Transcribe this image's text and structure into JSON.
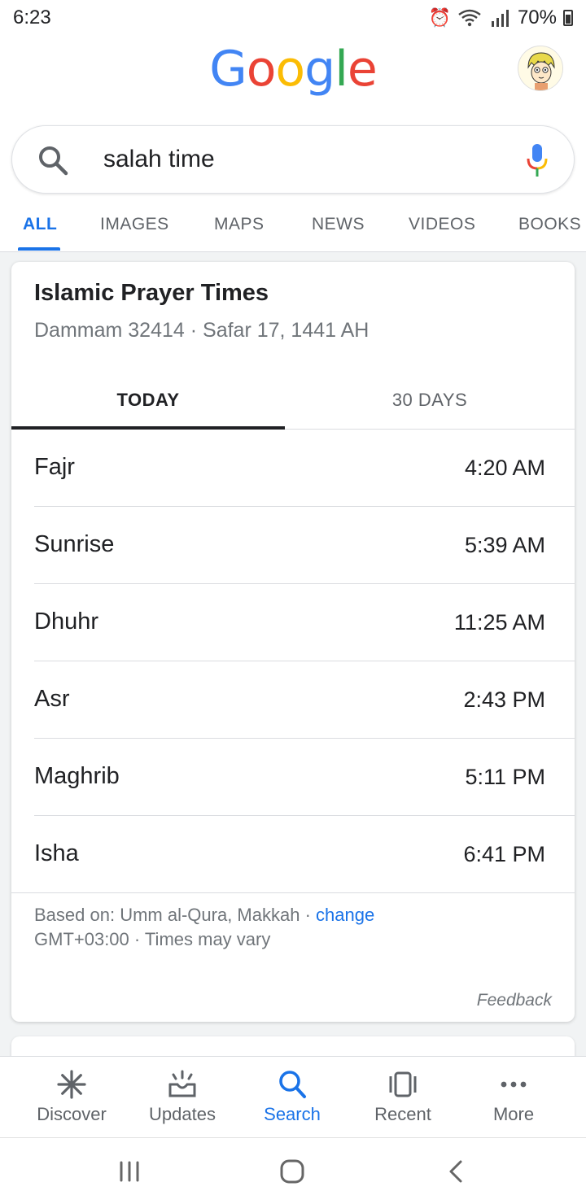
{
  "status_bar": {
    "time": "6:23",
    "battery": "70%",
    "network": "R"
  },
  "header": {
    "logo": "Google"
  },
  "search": {
    "query": "salah time"
  },
  "tabs": [
    {
      "label": "ALL"
    },
    {
      "label": "IMAGES"
    },
    {
      "label": "MAPS"
    },
    {
      "label": "NEWS"
    },
    {
      "label": "VIDEOS"
    },
    {
      "label": "BOOKS"
    }
  ],
  "card": {
    "title": "Islamic Prayer Times",
    "subtitle": "Dammam 32414 · Safar 17, 1441 AH",
    "tab_today": "TODAY",
    "tab_30days": "30 DAYS",
    "prayers": [
      {
        "name": "Fajr",
        "time": "4:20 AM"
      },
      {
        "name": "Sunrise",
        "time": "5:39 AM"
      },
      {
        "name": "Dhuhr",
        "time": "11:25 AM"
      },
      {
        "name": "Asr",
        "time": "2:43 PM"
      },
      {
        "name": "Maghrib",
        "time": "5:11 PM"
      },
      {
        "name": "Isha",
        "time": "6:41 PM"
      }
    ],
    "based_on": "Based on: Umm al-Qura, Makkah · ",
    "change_link": "change",
    "timezone_note": "GMT+03:00 · Times may vary",
    "feedback": "Feedback"
  },
  "bottom_nav": [
    {
      "label": "Discover",
      "icon": "asterisk-icon"
    },
    {
      "label": "Updates",
      "icon": "inbox-icon"
    },
    {
      "label": "Search",
      "icon": "search-icon"
    },
    {
      "label": "Recent",
      "icon": "recent-cards-icon"
    },
    {
      "label": "More",
      "icon": "more-dots-icon"
    }
  ],
  "colors": {
    "accent": "#1a73e8",
    "blue": "#4285F4",
    "red": "#EA4335",
    "yellow": "#FBBC05",
    "green": "#34A853"
  }
}
